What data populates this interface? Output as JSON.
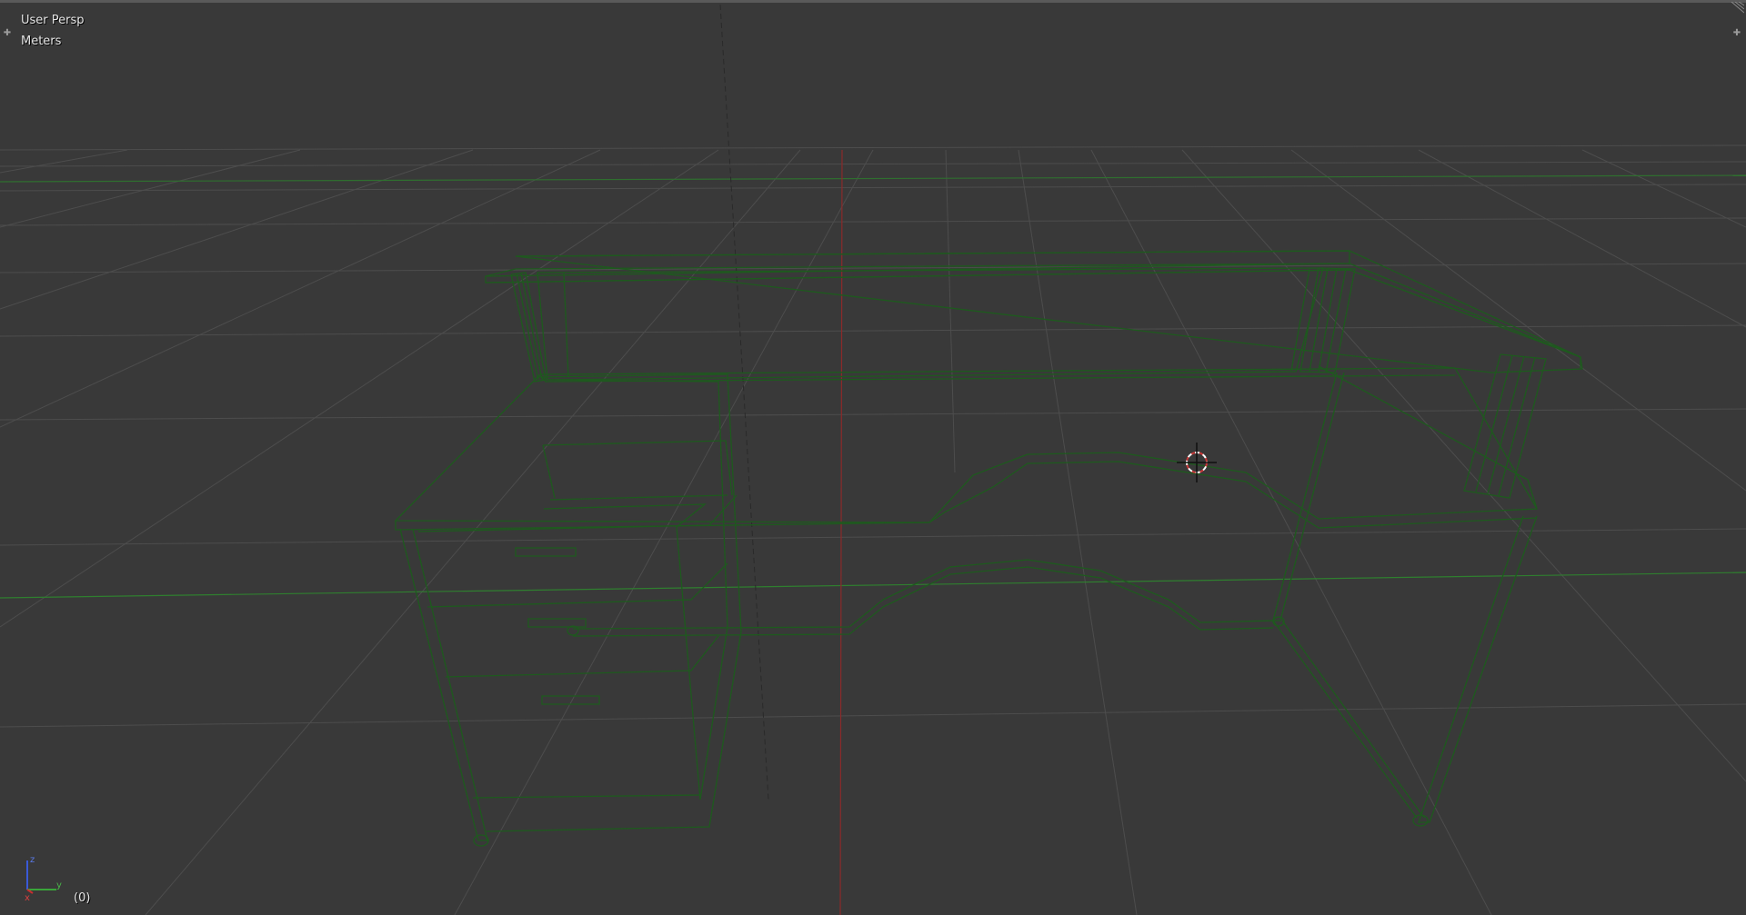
{
  "viewport": {
    "view_name": "User Persp",
    "units": "Meters",
    "frame": "(0)"
  },
  "gizmo": {
    "z_label": "z",
    "y_label": "y",
    "x_label": "x"
  },
  "colors": {
    "background": "#393939",
    "grid": "#4c4c4c",
    "wire": "#1f5a1f",
    "axis_x": "#b02020",
    "axis_y": "#2f8f2f",
    "cursor_red": "#e0e0e0"
  },
  "icons": {
    "corner_left": "plus-icon",
    "corner_right": "plus-icon",
    "corner_split": "area-split-icon",
    "cursor": "3d-cursor-icon"
  }
}
